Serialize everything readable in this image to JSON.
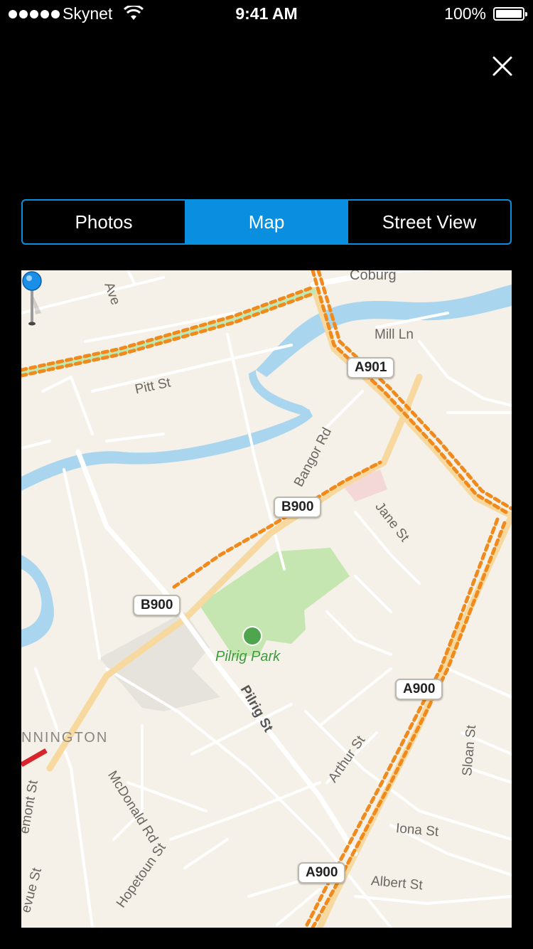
{
  "status_bar": {
    "carrier": "Skynet",
    "time": "9:41 AM",
    "battery": "100%"
  },
  "tabs": [
    {
      "label": "Photos",
      "selected": false
    },
    {
      "label": "Map",
      "selected": true
    },
    {
      "label": "Street View",
      "selected": false
    }
  ],
  "map": {
    "streets": {
      "coburg": "Coburg",
      "ave": "Ave",
      "mill_ln": "Mill Ln",
      "pitt_st": "Pitt St",
      "bangor_rd": "Bangor Rd",
      "jane_st": "Jane St",
      "pilrig_st": "Pilrig St",
      "arthur_st": "Arthur St",
      "mcdonald_rd": "McDonald Rd",
      "hopetoun_st": "Hopetoun St",
      "sloan_st": "Sloan St",
      "iona_st": "Iona St",
      "albert_st": "Albert St",
      "emont_st": "emont St",
      "evue_st": "evue St"
    },
    "district": "NNINGTON",
    "park": "Pilrig Park",
    "shields": {
      "a901": "A901",
      "b900_upper": "B900",
      "b900_lower": "B900",
      "a900_mid": "A900",
      "a900_low": "A900"
    }
  },
  "colors": {
    "accent": "#0a8fe0",
    "map_bg": "#f5f1e8",
    "road_major": "#f7d9a0",
    "traffic": "#f08a1c",
    "water": "#a9d6ee",
    "park": "#c5e6b0"
  },
  "icons": {
    "close": "close-icon",
    "wifi": "wifi-icon",
    "pin": "map-pin-icon",
    "park": "tree-icon"
  }
}
